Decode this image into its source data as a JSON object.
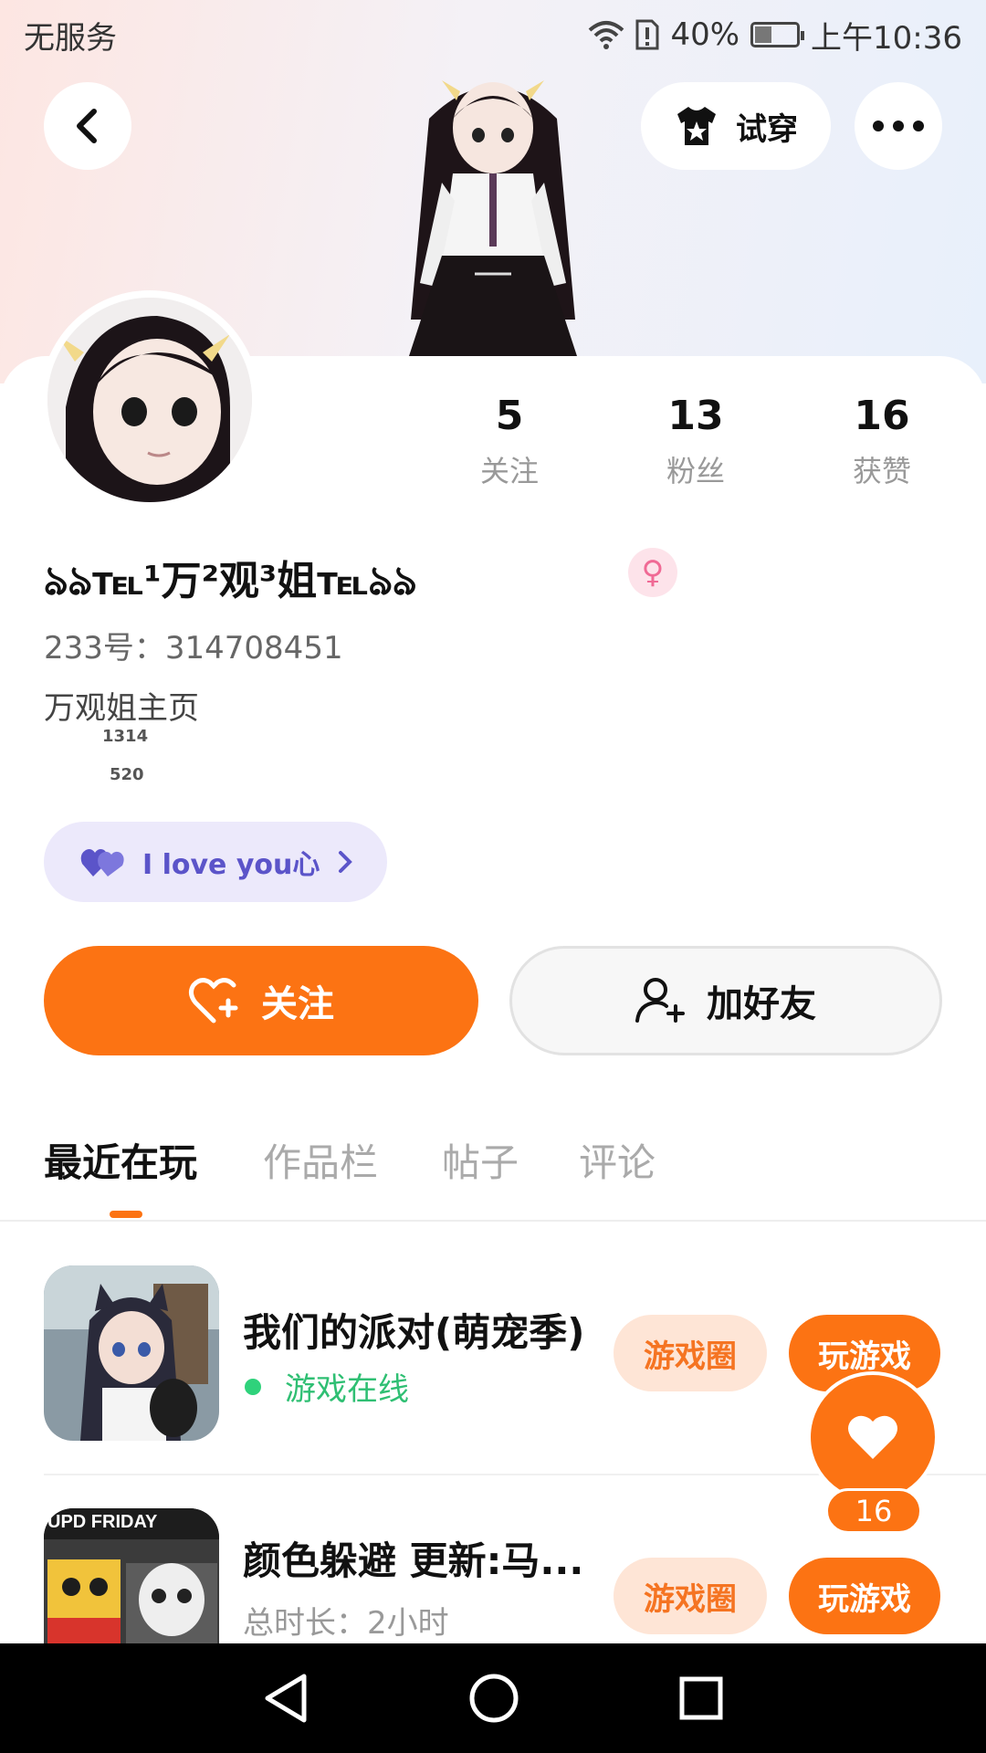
{
  "status_bar": {
    "carrier": "无服务",
    "battery": "40%",
    "battery_level": 0.4,
    "time": "上午10:36"
  },
  "header": {
    "try_on_label": "试穿"
  },
  "stats": [
    {
      "value": "5",
      "label": "关注"
    },
    {
      "value": "13",
      "label": "粉丝"
    },
    {
      "value": "16",
      "label": "获赞"
    }
  ],
  "profile": {
    "nickname": "ঌঌ℡¹万²观³姐℡ঌঌ",
    "gender": "♀",
    "uid": "233号：314708451",
    "bio": "万观姐主页",
    "bio_line2": "1314",
    "bio_line3": "520",
    "badge_label": "I love you心"
  },
  "actions": {
    "follow_label": "关注",
    "add_friend_label": "加好友"
  },
  "tabs": [
    "最近在玩",
    "作品栏",
    "帖子",
    "评论"
  ],
  "games": [
    {
      "title": "我们的派对(萌宠季)",
      "status": "游戏在线",
      "circle_label": "游戏圈",
      "play_label": "玩游戏"
    },
    {
      "title": "颜色躲避 更新:马...",
      "status": "总时长：2小时",
      "circle_label": "游戏圈",
      "play_label": "玩游戏",
      "icon_text": "UPD FRIDAY"
    }
  ],
  "floating_like": {
    "count": "16"
  },
  "colors": {
    "accent": "#fc7313",
    "online": "#2fbf73",
    "badge_purple": "#5b54c9"
  }
}
